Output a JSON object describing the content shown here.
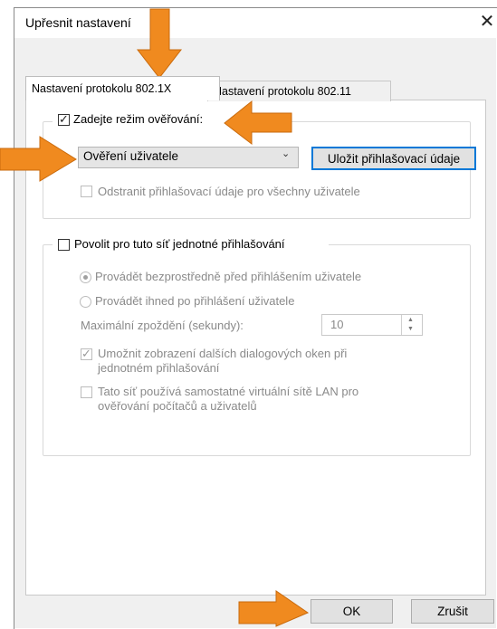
{
  "dialog": {
    "title": "Upřesnit nastavení",
    "close_glyph": "✕",
    "accent_color": "#0078d7",
    "annotation_color": "#f08a1f"
  },
  "tabs": [
    {
      "label": "Nastavení protokolu 802.1X",
      "active": true
    },
    {
      "label": "Nastavení protokolu 802.11",
      "active": false
    }
  ],
  "auth_group": {
    "checkbox_label": "Zadejte režim ověřování:",
    "checked": true,
    "mode_select": {
      "value": "Ověření uživatele"
    },
    "save_button_label": "Uložit přihlašovací údaje",
    "remove_creds_label": "Odstranit přihlašovací údaje pro všechny uživatele",
    "remove_creds_checked": false
  },
  "sso_group": {
    "checkbox_label": "Povolit pro tuto síť jednotné přihlašování",
    "checked": false,
    "radio_before": "Provádět bezprostředně před přihlášením uživatele",
    "radio_after": "Provádět ihned po přihlášení uživatele",
    "selected_radio": "before",
    "max_delay_label": "Maximální zpoždění (sekundy):",
    "max_delay_value": "10",
    "allow_dialogs_label_line1": "Umožnit zobrazení dalších dialogových oken při",
    "allow_dialogs_label_line2": "jednotném přihlašování",
    "allow_dialogs_checked": true,
    "separate_vlan_label_line1": "Tato síť používá samostatné virtuální sítě LAN pro",
    "separate_vlan_label_line2": "ověřování počítačů a uživatelů",
    "separate_vlan_checked": false
  },
  "footer": {
    "ok_label": "OK",
    "cancel_label": "Zrušit"
  }
}
